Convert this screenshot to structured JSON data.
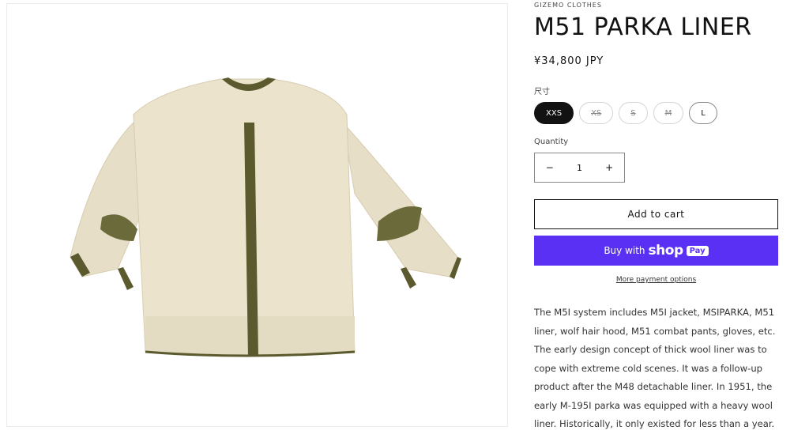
{
  "product": {
    "vendor": "GIZEMO CLOTHES",
    "title": "M51 PARKA LINER",
    "price": "¥34,800 JPY",
    "size_label": "尺寸",
    "sizes": [
      {
        "label": "XXS",
        "state": "selected"
      },
      {
        "label": "XS",
        "state": "unavailable"
      },
      {
        "label": "S",
        "state": "unavailable"
      },
      {
        "label": "M",
        "state": "unavailable"
      },
      {
        "label": "L",
        "state": "available"
      }
    ],
    "quantity_label": "Quantity",
    "quantity": {
      "minus": "−",
      "value": "1",
      "plus": "+"
    },
    "add_to_cart": "Add to cart",
    "buy_with": "Buy with",
    "shop_word": "shop",
    "pay_badge": "Pay",
    "more_payment": "More payment options",
    "description": "The M5I system includes M5I jacket, MSIPARKA, M51 liner, wolf hair hood, M51 combat pants, gloves, etc. The early design concept of thick wool liner was to cope with extreme cold scenes. It was a follow-up product after the M48 detachable liner. In 1951, the early M-195I parka was equipped with a heavy wool liner. Historically, it only existed for less than a year."
  },
  "colors": {
    "accent": "#5a31f4",
    "selected": "#121212",
    "fleece": "#e8e0c8",
    "olive": "#5b5a2e"
  },
  "icons": {
    "product_image": "fleece-liner-jacket"
  }
}
